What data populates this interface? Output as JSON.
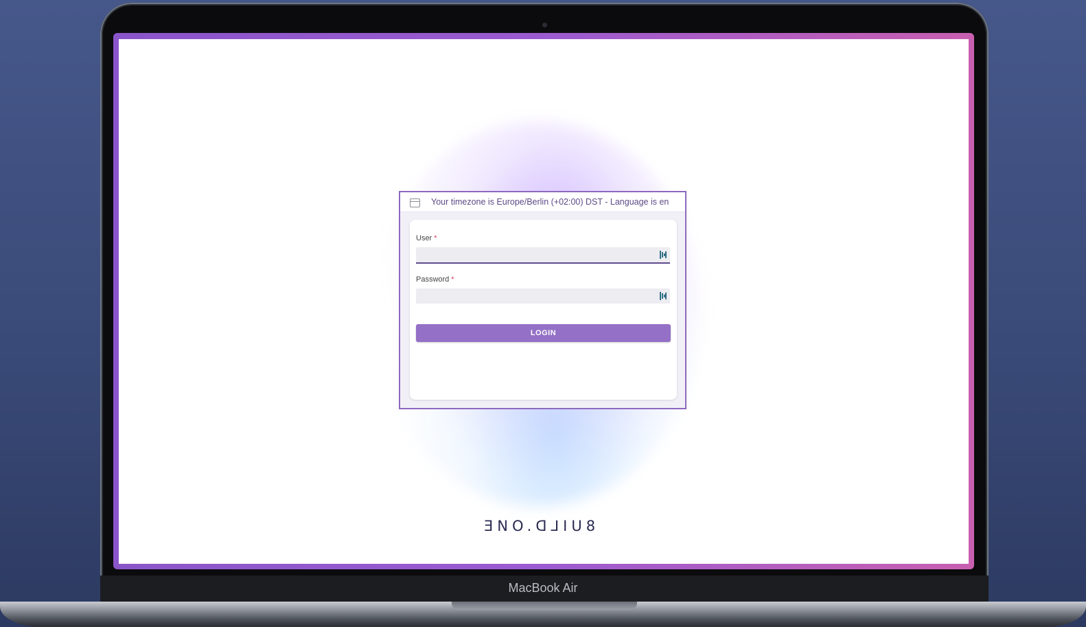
{
  "device": {
    "model_label": "MacBook Air"
  },
  "login": {
    "timezone_notice": "Your timezone is Europe/Berlin (+02:00) DST - Language is en",
    "user_label": "User",
    "password_label": "Password",
    "required_marker": "*",
    "user_value": "",
    "password_value": "",
    "login_button": "LOGIN"
  },
  "branding": {
    "logo_text": "ƎNO.ᗡ⅃IU8"
  },
  "colors": {
    "accent": "#9471c6",
    "frame": "#8a55c9",
    "required": "#d33a5c"
  },
  "icons": {
    "timezone": "calendar-icon",
    "credential": "password-manager-icon"
  }
}
